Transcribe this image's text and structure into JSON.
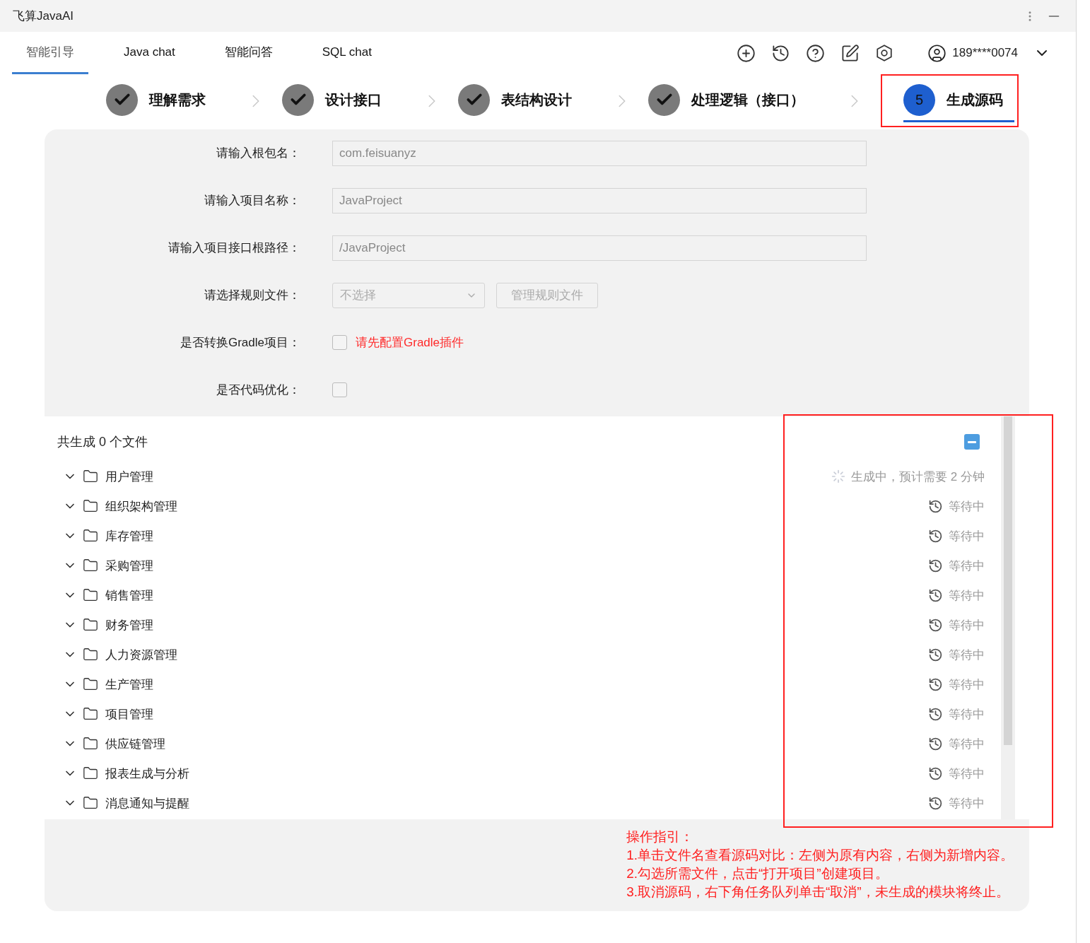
{
  "window": {
    "title": "飞算JavaAI"
  },
  "tabs": [
    {
      "label": "智能引导",
      "selected": true
    },
    {
      "label": "Java chat",
      "selected": false
    },
    {
      "label": "智能问答",
      "selected": false
    },
    {
      "label": "SQL chat",
      "selected": false
    }
  ],
  "user": {
    "name": "189****0074"
  },
  "steps": [
    {
      "label": "理解需求",
      "done": true,
      "selected": false
    },
    {
      "label": "设计接口",
      "done": true,
      "selected": false
    },
    {
      "label": "表结构设计",
      "done": true,
      "selected": false
    },
    {
      "label": "处理逻辑（接口）",
      "done": true,
      "selected": false
    },
    {
      "label": "生成源码",
      "done": false,
      "number": "5",
      "selected": true
    }
  ],
  "form": [
    {
      "kind": "text",
      "label": "请输入根包名：",
      "value": "com.feisuanyz"
    },
    {
      "kind": "text",
      "label": "请输入项目名称：",
      "value": "JavaProject"
    },
    {
      "kind": "text",
      "label": "请输入项目接口根路径：",
      "value": "/JavaProject"
    },
    {
      "kind": "select",
      "label": "请选择规则文件：",
      "value": "不选择",
      "button": "管理规则文件"
    },
    {
      "kind": "checkbox",
      "label": "是否转换Gradle项目：",
      "checked": false,
      "note": "请先配置Gradle插件"
    },
    {
      "kind": "checkbox",
      "label": "是否代码优化：",
      "checked": false
    }
  ],
  "files": {
    "summary": "共生成 0 个文件",
    "modules": [
      {
        "name": "用户管理",
        "kind": "generating",
        "status": "生成中，预计需要 2 分钟"
      },
      {
        "name": "组织架构管理",
        "kind": "waiting",
        "status": "等待中"
      },
      {
        "name": "库存管理",
        "kind": "waiting",
        "status": "等待中"
      },
      {
        "name": "采购管理",
        "kind": "waiting",
        "status": "等待中"
      },
      {
        "name": "销售管理",
        "kind": "waiting",
        "status": "等待中"
      },
      {
        "name": "财务管理",
        "kind": "waiting",
        "status": "等待中"
      },
      {
        "name": "人力资源管理",
        "kind": "waiting",
        "status": "等待中"
      },
      {
        "name": "生产管理",
        "kind": "waiting",
        "status": "等待中"
      },
      {
        "name": "项目管理",
        "kind": "waiting",
        "status": "等待中"
      },
      {
        "name": "供应链管理",
        "kind": "waiting",
        "status": "等待中"
      },
      {
        "name": "报表生成与分析",
        "kind": "waiting",
        "status": "等待中"
      },
      {
        "name": "消息通知与提醒",
        "kind": "waiting",
        "status": "等待中"
      }
    ]
  },
  "guide": {
    "title": "操作指引：",
    "lines": [
      "1.单击文件名查看源码对比：左侧为原有内容，右侧为新增内容。",
      "2.勾选所需文件，点击“打开项目”创建项目。",
      "3.取消源码，右下角任务队列单击“取消”，未生成的模块将终止。"
    ]
  }
}
